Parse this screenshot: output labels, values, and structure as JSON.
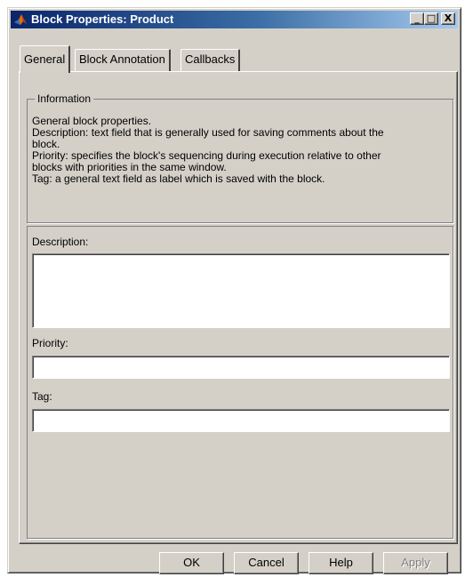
{
  "window": {
    "title": "Block Properties: Product",
    "minimize": "_",
    "maximize": "□",
    "close": "X"
  },
  "tabs": [
    {
      "label": "General",
      "active": true
    },
    {
      "label": "Block Annotation",
      "active": false
    },
    {
      "label": "Callbacks",
      "active": false
    }
  ],
  "information": {
    "legend": "Information",
    "lines": [
      "General block properties.",
      "Description: text field that is generally used for saving comments about the",
      "block.",
      "Priority: specifies the block's sequencing during execution relative to other",
      "blocks with priorities in the same window.",
      "Tag: a general text field as label which is saved with the block."
    ]
  },
  "fields": {
    "description_label": "Description:",
    "description_value": "",
    "priority_label": "Priority:",
    "priority_value": "",
    "tag_label": "Tag:",
    "tag_value": ""
  },
  "buttons": {
    "ok": "OK",
    "cancel": "Cancel",
    "help": "Help",
    "apply": "Apply"
  },
  "colors": {
    "title_start": "#0a246a",
    "title_end": "#a6caf0",
    "dialog_bg": "#d4d0c8"
  }
}
